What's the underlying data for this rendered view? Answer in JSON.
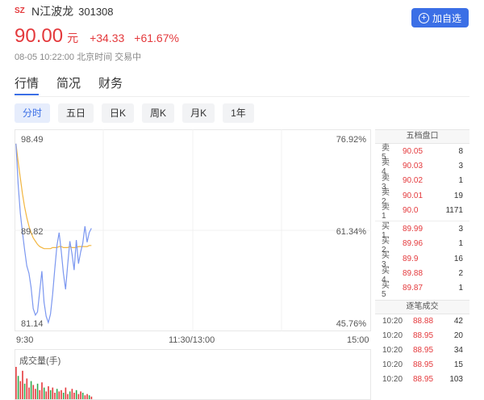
{
  "stock": {
    "market": "SZ",
    "name": "N江波龙",
    "code": "301308",
    "price": "90.00",
    "unit": "元",
    "change": "+34.33",
    "change_pct": "+61.67%",
    "meta": "08-05 10:22:00 北京时间 交易中"
  },
  "actions": {
    "add_watchlist": "加自选"
  },
  "tabs": [
    "行情",
    "简况",
    "财务"
  ],
  "periods": [
    "分时",
    "五日",
    "日K",
    "周K",
    "月K",
    "1年"
  ],
  "colors": {
    "up": "#e4393c",
    "accent": "#3b6fe6",
    "price_line": "#7b97f0",
    "avg_line": "#f2b640"
  },
  "chart": {
    "y_left": [
      "98.49",
      "89.82",
      "81.14"
    ],
    "y_right": [
      "76.92%",
      "61.34%",
      "45.76%"
    ],
    "x_labels": [
      "9:30",
      "11:30/13:00",
      "15:00"
    ],
    "volume_title": "成交量(手)"
  },
  "chart_data": {
    "type": "line",
    "ylim": [
      81.14,
      98.49
    ],
    "x_range_minutes": 240,
    "series": [
      {
        "values": [
          97.9,
          94.1,
          91.4,
          89.6,
          88.0,
          86.5,
          85.8,
          84.5,
          82.5,
          81.9,
          82.2,
          84.1,
          86.0,
          83.1,
          81.8,
          81.2,
          82.0,
          83.8,
          86.2,
          88.4,
          89.6,
          87.9,
          85.8,
          84.3,
          86.6,
          88.8,
          87.6,
          86.1,
          88.9,
          86.7,
          87.8,
          88.6,
          90.2,
          88.7,
          89.6,
          90.0
        ]
      },
      {
        "values": [
          97.9,
          96.2,
          94.7,
          93.2,
          92.0,
          91.0,
          90.2,
          89.6,
          89.1,
          88.8,
          88.5,
          88.3,
          88.2,
          88.1,
          88.1,
          88.1,
          88.1,
          88.2,
          88.2,
          88.2,
          88.3,
          88.3,
          88.2,
          88.2,
          88.2,
          88.3,
          88.2,
          88.2,
          88.2,
          88.3,
          88.3,
          88.3,
          88.3,
          88.3,
          88.4,
          88.4
        ]
      }
    ],
    "volume": [
      25,
      18,
      14,
      22,
      12,
      16,
      9,
      14,
      11,
      8,
      12,
      7,
      13,
      9,
      6,
      10,
      7,
      9,
      5,
      8,
      6,
      7,
      5,
      9,
      4,
      6,
      8,
      5,
      7,
      4,
      6,
      5,
      3,
      4,
      3,
      2
    ]
  },
  "order_book": {
    "title": "五档盘口",
    "asks": [
      {
        "label": "卖5",
        "price": "90.05",
        "vol": "8"
      },
      {
        "label": "卖4",
        "price": "90.03",
        "vol": "3"
      },
      {
        "label": "卖3",
        "price": "90.02",
        "vol": "1"
      },
      {
        "label": "卖2",
        "price": "90.01",
        "vol": "19"
      },
      {
        "label": "卖1",
        "price": "90.0",
        "vol": "1171"
      }
    ],
    "bids": [
      {
        "label": "买1",
        "price": "89.99",
        "vol": "3"
      },
      {
        "label": "买2",
        "price": "89.96",
        "vol": "1"
      },
      {
        "label": "买3",
        "price": "89.9",
        "vol": "16"
      },
      {
        "label": "买4",
        "price": "89.88",
        "vol": "2"
      },
      {
        "label": "买5",
        "price": "89.87",
        "vol": "1"
      }
    ]
  },
  "trades": {
    "title": "逐笔成交",
    "rows": [
      {
        "time": "10:20",
        "price": "88.88",
        "vol": "42"
      },
      {
        "time": "10:20",
        "price": "88.95",
        "vol": "20"
      },
      {
        "time": "10:20",
        "price": "88.95",
        "vol": "34"
      },
      {
        "time": "10:20",
        "price": "88.95",
        "vol": "15"
      },
      {
        "time": "10:20",
        "price": "88.95",
        "vol": "103"
      }
    ]
  }
}
